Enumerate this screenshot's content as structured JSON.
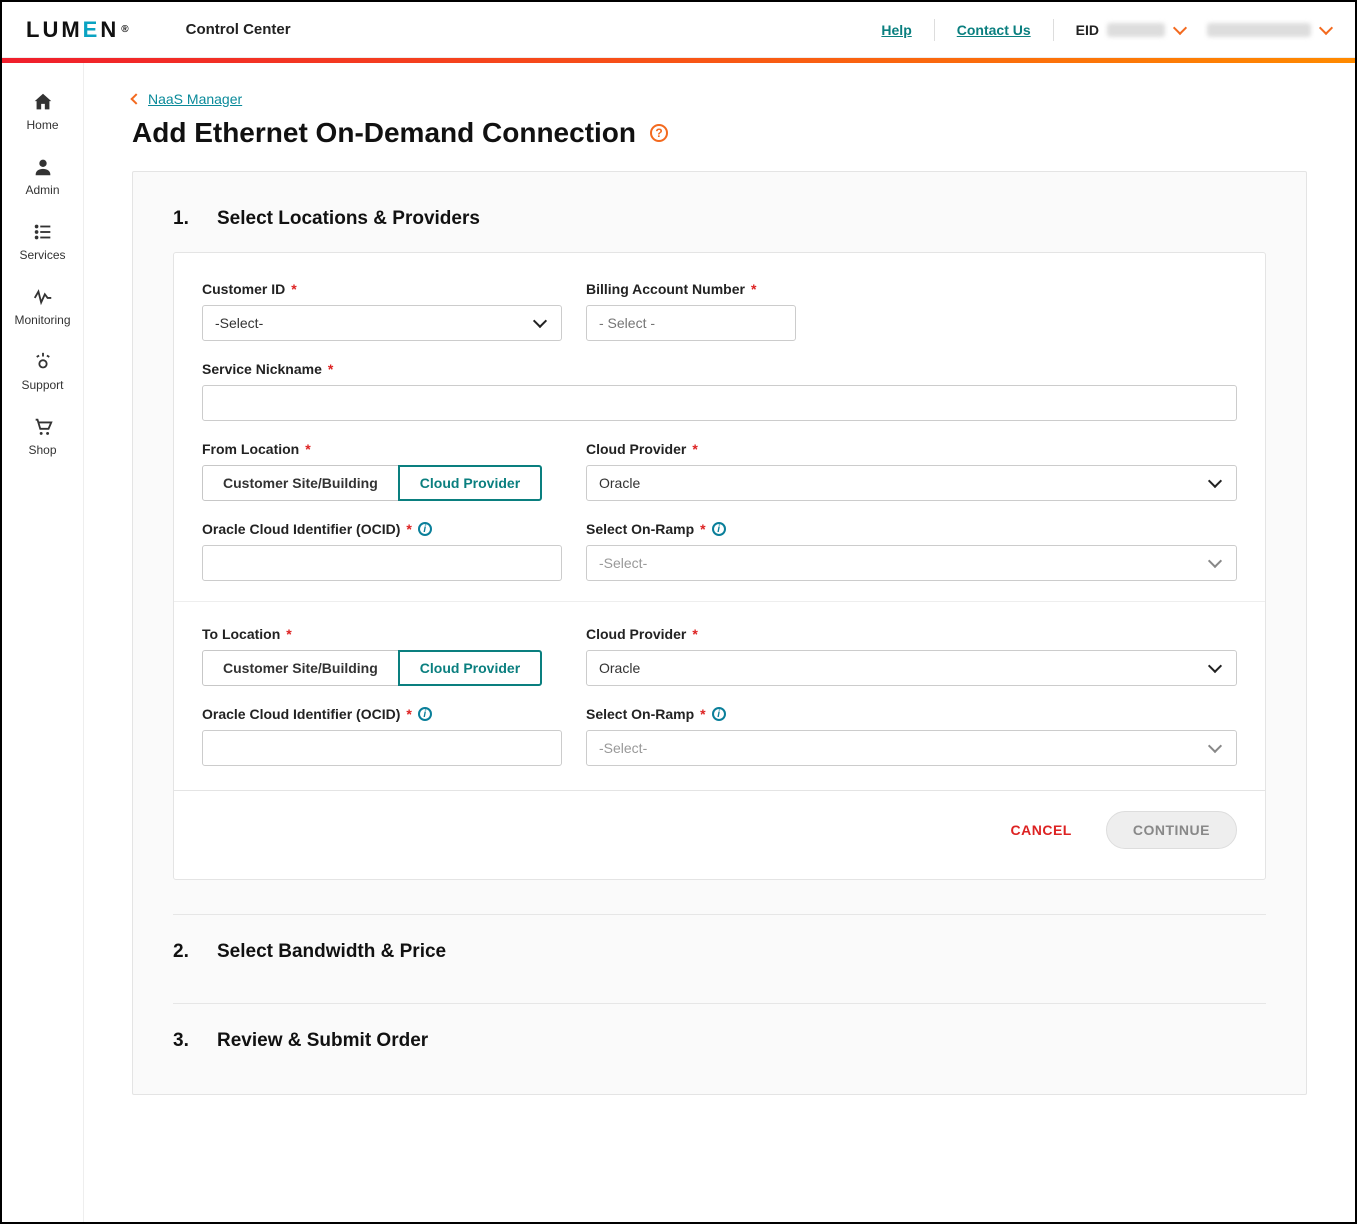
{
  "header": {
    "logo_prefix": "LUM",
    "logo_e": "E",
    "logo_suffix": "N",
    "logo_tm": "®",
    "app_title": "Control Center",
    "help": "Help",
    "contact": "Contact Us",
    "eid_label": "EID"
  },
  "sidebar": {
    "items": [
      {
        "label": "Home"
      },
      {
        "label": "Admin"
      },
      {
        "label": "Services"
      },
      {
        "label": "Monitoring"
      },
      {
        "label": "Support"
      },
      {
        "label": "Shop"
      }
    ]
  },
  "breadcrumb": {
    "back": "NaaS Manager"
  },
  "page": {
    "title": "Add Ethernet On-Demand Connection"
  },
  "step1": {
    "num": "1.",
    "title": "Select Locations & Providers",
    "customer_id_label": "Customer ID",
    "customer_id_value": "-Select-",
    "ban_label": "Billing Account Number",
    "ban_placeholder": "- Select -",
    "nickname_label": "Service Nickname",
    "from_label": "From Location",
    "to_label": "To Location",
    "toggle_customer": "Customer Site/Building",
    "toggle_cloud": "Cloud Provider",
    "cloud_provider_label": "Cloud Provider",
    "cloud_provider_value": "Oracle",
    "ocid_label": "Oracle Cloud Identifier (OCID)",
    "onramp_label": "Select On-Ramp",
    "onramp_placeholder": "-Select-",
    "cancel": "CANCEL",
    "continue": "CONTINUE"
  },
  "step2": {
    "num": "2.",
    "title": "Select Bandwidth & Price"
  },
  "step3": {
    "num": "3.",
    "title": "Review & Submit Order"
  }
}
